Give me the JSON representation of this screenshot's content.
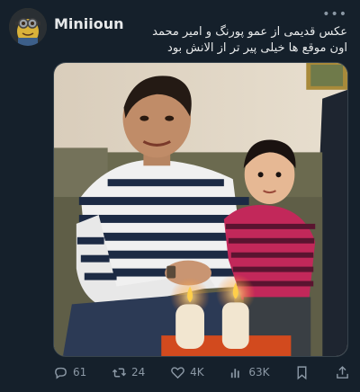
{
  "tweet": {
    "author": {
      "display_name": "Miniioun",
      "avatar_icon": "avatar-image"
    },
    "more_icon": "more-options-icon",
    "text_lines": [
      "عکس قدیمی از عمو پورنگ و امیر محمد",
      "اون موقع ها خیلی پیر تر از الانش بود"
    ],
    "media": {
      "alt_icon": "photo-image"
    },
    "actions": {
      "reply": {
        "icon": "reply-icon",
        "count": "61"
      },
      "retweet": {
        "icon": "retweet-icon",
        "count": "24"
      },
      "like": {
        "icon": "heart-icon",
        "count": "4K"
      },
      "views": {
        "icon": "views-icon",
        "count": "63K"
      },
      "bookmark": {
        "icon": "bookmark-icon"
      },
      "share": {
        "icon": "share-icon"
      }
    }
  },
  "colors": {
    "background": "#15202b",
    "text": "#e7e9ea",
    "muted": "#8b98a5"
  }
}
